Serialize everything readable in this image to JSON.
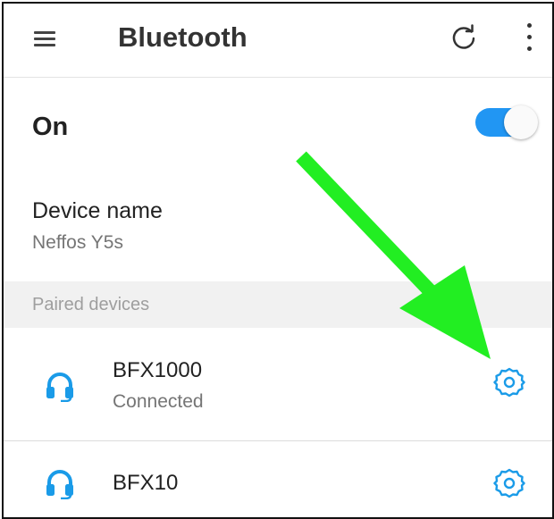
{
  "appbar": {
    "title": "Bluetooth",
    "menu_icon": "hamburger-menu-icon",
    "refresh_icon": "refresh-icon",
    "more_icon": "more-vertical-icon"
  },
  "bluetooth": {
    "state_label": "On",
    "enabled": true,
    "toggle_color": "#2196f3"
  },
  "device": {
    "label": "Device name",
    "value": "Neffos Y5s"
  },
  "paired": {
    "header": "Paired devices",
    "items": [
      {
        "name": "BFX1000",
        "status": "Connected",
        "icon": "headphones-icon",
        "settings_icon": "gear-icon"
      },
      {
        "name": "BFX10",
        "icon": "headphones-icon",
        "settings_icon": "gear-icon"
      }
    ]
  },
  "annotation": {
    "arrow_color": "#22ee22",
    "points_to": "BFX1000 settings gear"
  },
  "accent_color": "#1a9be8"
}
